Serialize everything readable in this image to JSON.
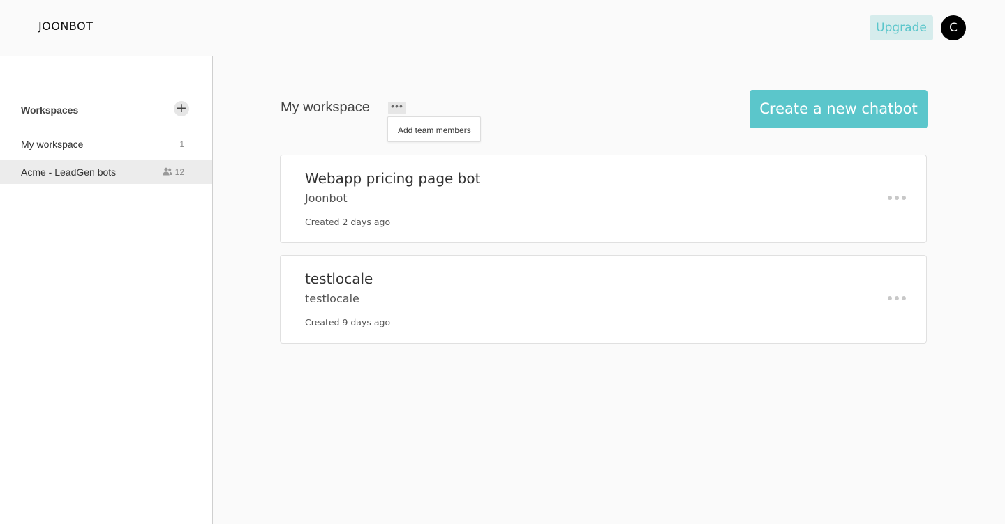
{
  "header": {
    "logo": "JOONBOT",
    "upgrade_label": "Upgrade",
    "avatar_initial": "C"
  },
  "sidebar": {
    "title": "Workspaces",
    "add_icon": "plus-icon",
    "items": [
      {
        "label": "My workspace",
        "count": "1",
        "shared": false,
        "active": false
      },
      {
        "label": "Acme - LeadGen bots",
        "count": "12",
        "shared": true,
        "active": true,
        "icon": "people-icon"
      }
    ]
  },
  "main": {
    "title": "My workspace",
    "more_icon": "ellipsis-icon",
    "dropdown": {
      "items": [
        "Add team members"
      ]
    },
    "create_label": "Create a new chatbot",
    "bots": [
      {
        "name": "Webapp pricing page bot",
        "subtitle": "Joonbot",
        "created": "Created 2 days ago"
      },
      {
        "name": "testlocale",
        "subtitle": "testlocale",
        "created": "Created 9 days ago"
      }
    ]
  },
  "colors": {
    "accent": "#5bc6cb",
    "upgrade_bg": "#d6ecec",
    "active_item_bg": "#ececec"
  }
}
